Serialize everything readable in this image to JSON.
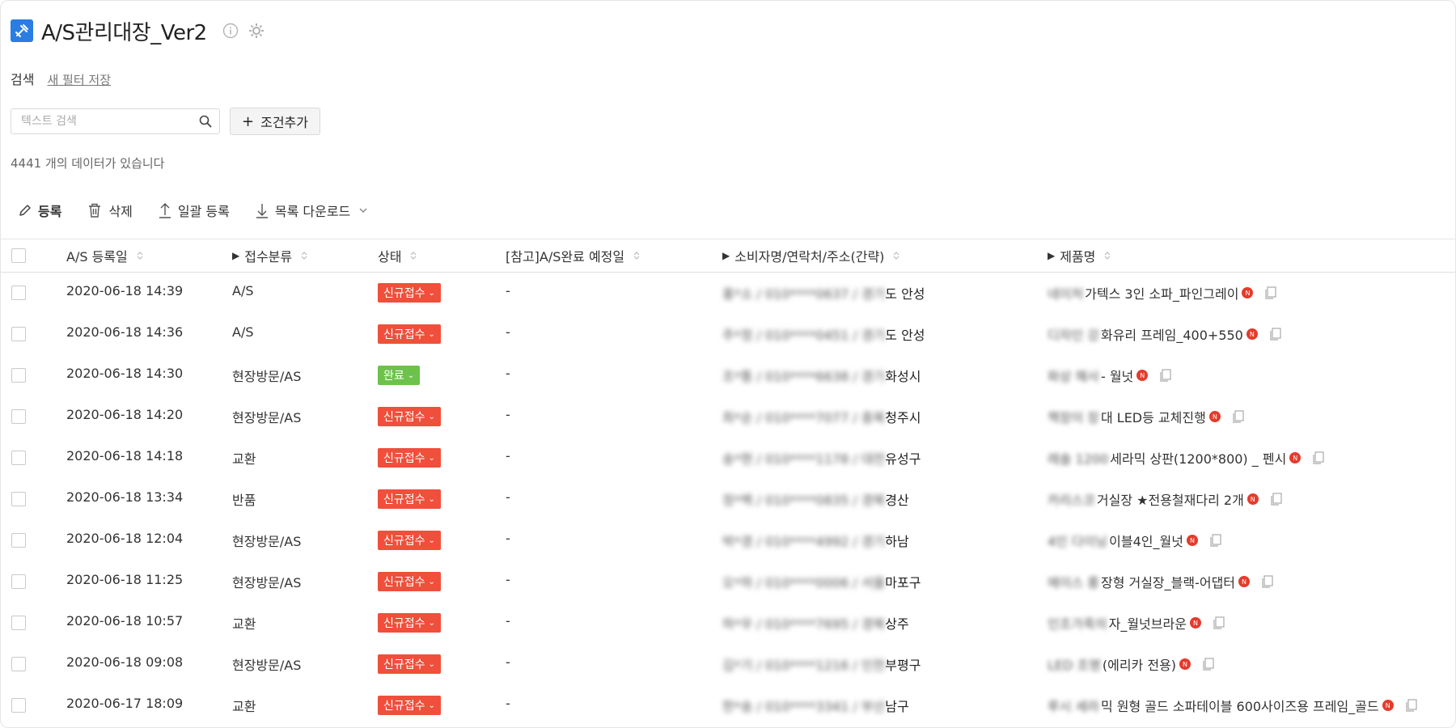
{
  "header": {
    "title": "A/S관리대장_Ver2"
  },
  "search": {
    "label": "검색",
    "save_filter": "새 필터 저장",
    "placeholder": "텍스트 검색",
    "add_condition": "조건추가"
  },
  "result_count": "4441 개의 데이터가 있습니다",
  "toolbar": {
    "register": "등록",
    "delete": "삭제",
    "bulk_register": "일괄 등록",
    "download": "목록 다운로드"
  },
  "columns": {
    "date": "A/S 등록일",
    "category": "접수분류",
    "status": "상태",
    "due": "[참고]A/S완료 예정일",
    "customer": "소비자명/연락처/주소(간략)",
    "product": "제품명"
  },
  "rows": [
    {
      "date": "2020-06-18 14:39",
      "category": "A/S",
      "status": "신규접수",
      "status_type": "new",
      "due": "-",
      "cust_blur": "홍*소 / 010****0637 / 경기",
      "cust_tail": "도 안성",
      "prod_blur": "네이처",
      "prod": "가텍스 3인 소파_파인그레이"
    },
    {
      "date": "2020-06-18 14:36",
      "category": "A/S",
      "status": "신규접수",
      "status_type": "new",
      "due": "-",
      "cust_blur": "주*정 / 010****0451 / 경기",
      "cust_tail": "도 안성",
      "prod_blur": "디자인 강",
      "prod": "화유리 프레임_400+550"
    },
    {
      "date": "2020-06-18 14:30",
      "category": "현장방문/AS",
      "status": "완료",
      "status_type": "done",
      "due": "-",
      "cust_blur": "조*통 / 010****6638 / 경기",
      "cust_tail": "화성시",
      "prod_blur": "파상 해사",
      "prod": "- 월넛"
    },
    {
      "date": "2020-06-18 14:20",
      "category": "현장방문/AS",
      "status": "신규접수",
      "status_type": "new",
      "due": "-",
      "cust_blur": "최*순 / 010****7077 / 충북",
      "cust_tail": "청주시",
      "prod_blur": "책장이 장",
      "prod": "대 LED등 교체진행"
    },
    {
      "date": "2020-06-18 14:18",
      "category": "교환",
      "status": "신규접수",
      "status_type": "new",
      "due": "-",
      "cust_blur": "송*현 / 010****1178 / 대전",
      "cust_tail": "유성구",
      "prod_blur": "레솔 1200",
      "prod": "세라믹 상판(1200*800) _ 펜시"
    },
    {
      "date": "2020-06-18 13:34",
      "category": "반품",
      "status": "신규접수",
      "status_type": "new",
      "due": "-",
      "cust_blur": "정*백 / 010****0835 / 경북",
      "cust_tail": "경산",
      "prod_blur": "카리스코",
      "prod": "거실장 ★전용철재다리 2개"
    },
    {
      "date": "2020-06-18 12:04",
      "category": "현장방문/AS",
      "status": "신규접수",
      "status_type": "new",
      "due": "-",
      "cust_blur": "박*경 / 010****4992 / 경기",
      "cust_tail": "하남",
      "prod_blur": "4인 다이닝",
      "prod": "이블4인_월넛"
    },
    {
      "date": "2020-06-18 11:25",
      "category": "현장방문/AS",
      "status": "신규접수",
      "status_type": "new",
      "due": "-",
      "cust_blur": "오*하 / 010****0006 / 서울",
      "cust_tail": "마포구",
      "prod_blur": "에이스 롱",
      "prod": "장형 거실장_블랙-어댑터"
    },
    {
      "date": "2020-06-18 10:57",
      "category": "교환",
      "status": "신규접수",
      "status_type": "new",
      "due": "-",
      "cust_blur": "하*우 / 010****7695 / 경북",
      "cust_tail": "상주",
      "prod_blur": "인조가죽의",
      "prod": "자_월넛브라운"
    },
    {
      "date": "2020-06-18 09:08",
      "category": "현장방문/AS",
      "status": "신규접수",
      "status_type": "new",
      "due": "-",
      "cust_blur": "김*기 / 010****1216 / 인천",
      "cust_tail": "부평구",
      "prod_blur": "LED 조명",
      "prod": "(에리카 전용)"
    },
    {
      "date": "2020-06-17 18:09",
      "category": "교환",
      "status": "신규접수",
      "status_type": "new",
      "due": "-",
      "cust_blur": "한*송 / 010****3341 / 부산",
      "cust_tail": "남구",
      "prod_blur": "루시 세라",
      "prod": "믹 원형 골드 소파테이블 600사이즈용 프레임_골드"
    }
  ]
}
